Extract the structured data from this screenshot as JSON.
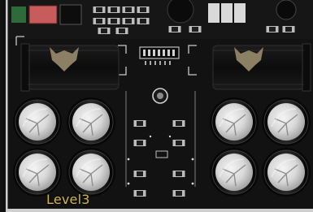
{
  "level": {
    "label": "Level3"
  },
  "colors": {
    "board": "#121212",
    "silkscreen": "#d6d6d6",
    "can_shell": "#141414",
    "capacitor_top": "#dcdcdc",
    "emblem": "#8c8064",
    "label": "#d4b44a",
    "frame": "#cfcfcf"
  },
  "icons": [
    "wolf-emblem-icon",
    "wolf-emblem-icon"
  ]
}
